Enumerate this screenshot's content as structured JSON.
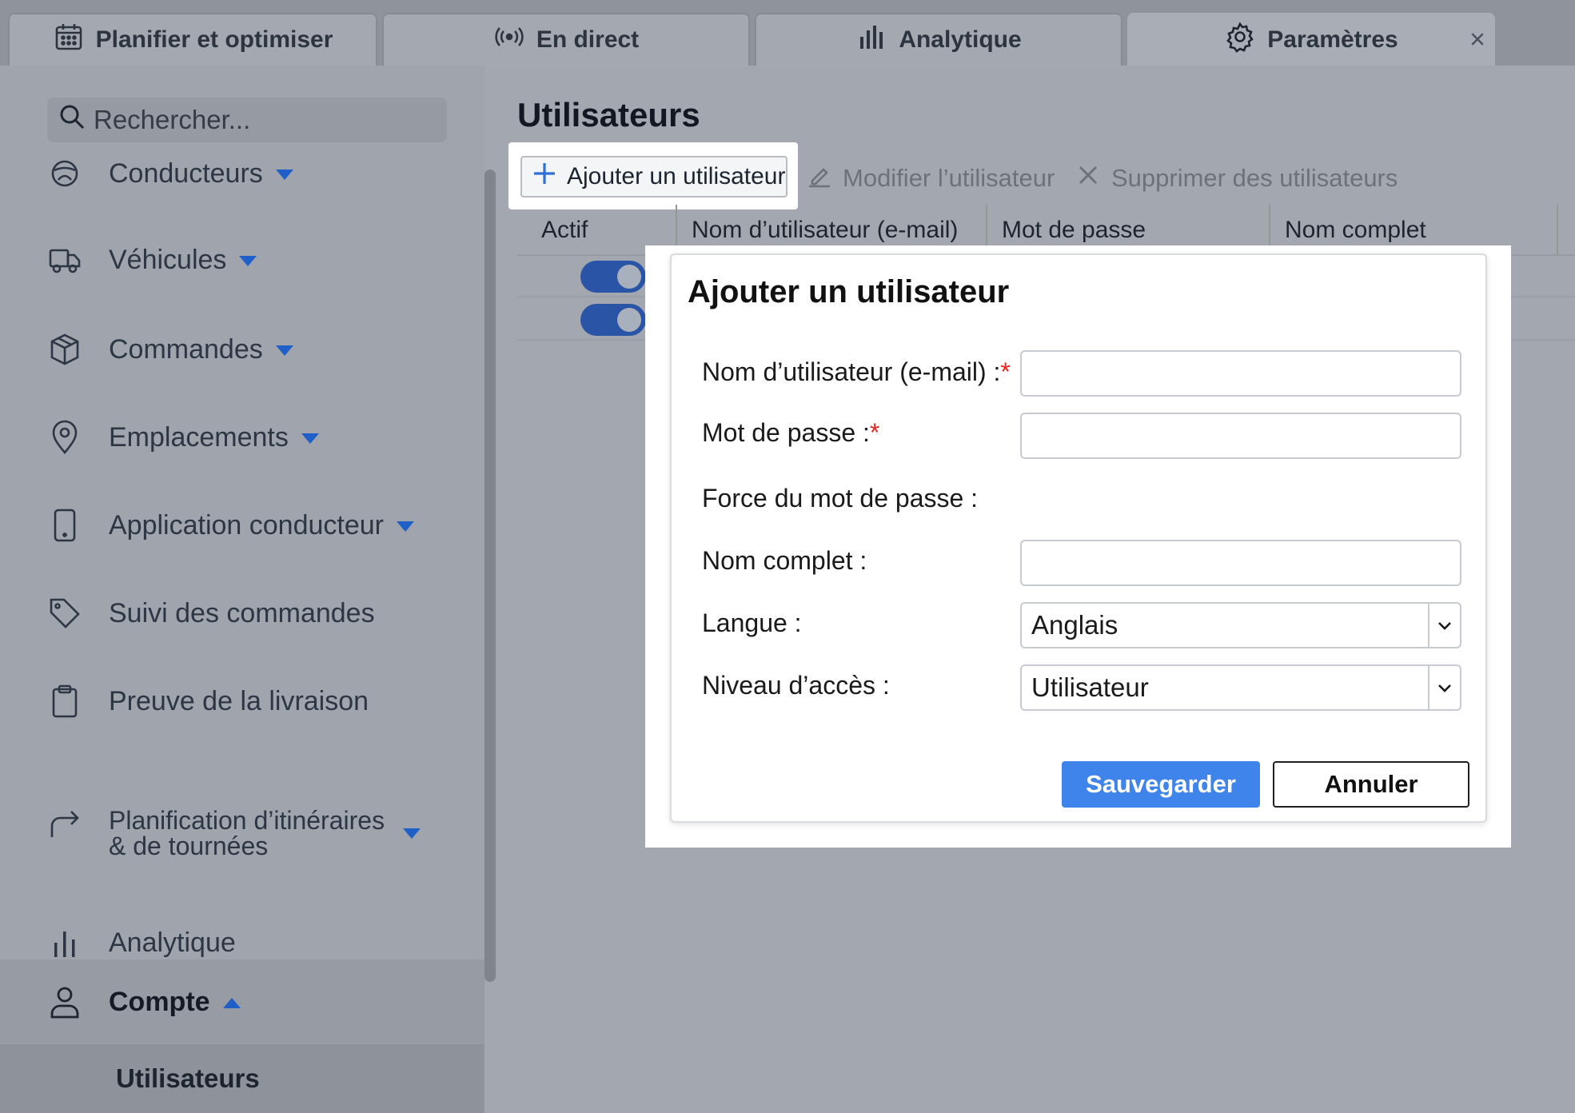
{
  "tabs": [
    {
      "label": "Planifier et optimiser",
      "icon": "calendar-icon"
    },
    {
      "label": "En direct",
      "icon": "broadcast-icon"
    },
    {
      "label": "Analytique",
      "icon": "bar-chart-icon"
    },
    {
      "label": "Paramètres",
      "icon": "gear-icon",
      "active": true,
      "close": "×"
    }
  ],
  "sidebar": {
    "search_placeholder": "Rechercher...",
    "items": [
      {
        "label": "Conducteurs",
        "icon": "steering-wheel-icon",
        "caret": "down"
      },
      {
        "label": "Véhicules",
        "icon": "truck-icon",
        "caret": "down"
      },
      {
        "label": "Commandes",
        "icon": "package-icon",
        "caret": "down"
      },
      {
        "label": "Emplacements",
        "icon": "map-pin-icon",
        "caret": "down"
      },
      {
        "label": "Application conducteur",
        "icon": "phone-icon",
        "caret": "down"
      },
      {
        "label": "Suivi des commandes",
        "icon": "tag-icon"
      },
      {
        "label": "Preuve de la livraison",
        "icon": "clipboard-icon"
      },
      {
        "label_line1": "Planification d’itinéraires",
        "label_line2": "& de tournées",
        "icon": "route-arrow-icon",
        "caret": "down"
      },
      {
        "label": "Analytique",
        "icon": "bar-chart-icon"
      },
      {
        "label": "Compte",
        "icon": "user-icon",
        "caret": "up"
      }
    ],
    "subitem": "Utilisateurs"
  },
  "main": {
    "title": "Utilisateurs",
    "toolbar": {
      "add": "Ajouter un utilisateur",
      "edit": "Modifier l’utilisateur",
      "delete": "Supprimer des utilisateurs"
    },
    "columns": [
      "Actif",
      "Nom d’utilisateur (e-mail)",
      "Mot de passe",
      "Nom complet"
    ],
    "rows": [
      {
        "active": true
      },
      {
        "active": true
      }
    ]
  },
  "modal": {
    "title": "Ajouter un utilisateur",
    "fields": {
      "username_label": "Nom d’utilisateur (e-mail) :",
      "password_label": "Mot de passe :",
      "strength_label": "Force du mot de passe :",
      "fullname_label": "Nom complet :",
      "language_label": "Langue :",
      "language_value": "Anglais",
      "access_label": "Niveau d’accès :",
      "access_value": "Utilisateur",
      "required_mark": "*"
    },
    "save": "Sauvegarder",
    "cancel": "Annuler"
  },
  "colors": {
    "accent": "#3e84ea",
    "toggle": "#2a54a6",
    "required": "#e0261f"
  }
}
